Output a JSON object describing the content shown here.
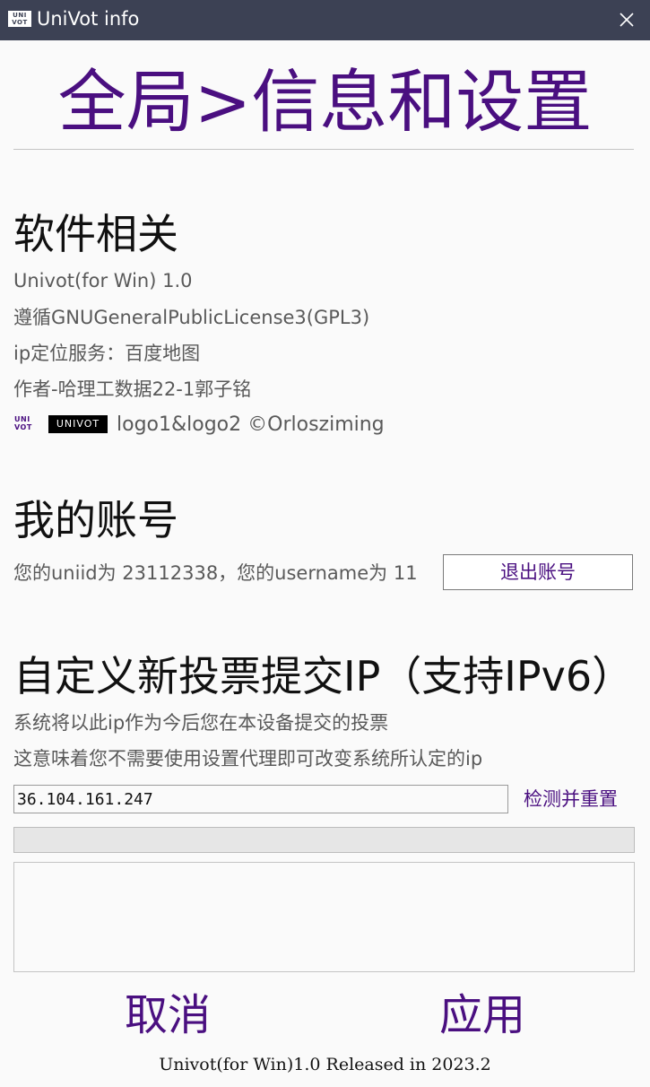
{
  "window": {
    "title": "UniVot info",
    "logo_text": "UNI VOT"
  },
  "page": {
    "title": "全局>信息和设置"
  },
  "software": {
    "heading": "软件相关",
    "version": "Univot(for Win) 1.0",
    "license": "遵循GNUGeneralPublicLicense3(GPL3)",
    "ip_service": "ip定位服务：百度地图",
    "author": "作者-哈理工数据22-1郭子铭",
    "logo1_text": "UNI VOT",
    "logo2_text": "UNIVOT",
    "logo_credit": "logo1&logo2 ©Orlosziming"
  },
  "account": {
    "heading": "我的账号",
    "info": "您的uniid为 23112338，您的username为 11",
    "logout_label": "退出账号"
  },
  "ip_settings": {
    "heading": "自定义新投票提交IP（支持IPv6）",
    "desc1": "系统将以此ip作为今后您在本设备提交的投票",
    "desc2": "这意味着您不需要使用设置代理即可改变系统所认定的ip",
    "ip_value": "36.104.161.247",
    "detect_label": "检测并重置",
    "progress_value": 0,
    "log_text": ""
  },
  "actions": {
    "cancel_label": "取消",
    "apply_label": "应用"
  },
  "footer": {
    "text": "Univot(for Win)1.0 Released in 2023.2"
  },
  "colors": {
    "titlebar": "#3c4154",
    "accent": "#4a0f80",
    "progress_fill": "#06b025"
  }
}
